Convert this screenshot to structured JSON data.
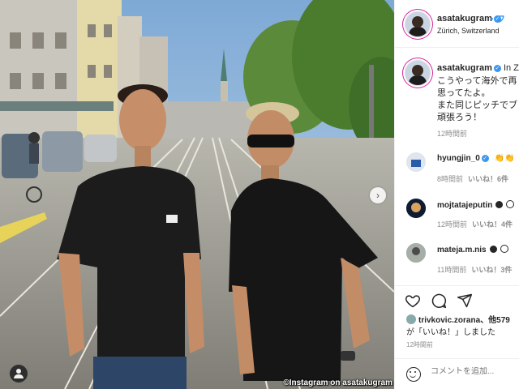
{
  "post": {
    "username": "asatakugram",
    "follow_label": "・フ",
    "location": "Zürich, Switzerland"
  },
  "caption": {
    "username": "asatakugram",
    "header_tail": "In Z",
    "body": "こうやって海外で再\n思ってたよ。\nまた同じピッチでブ\n頑張ろう！",
    "time": "12時間前"
  },
  "comments": [
    {
      "user": "hyungjin_0",
      "verified": true,
      "text": "👏👏",
      "time": "8時間前",
      "likes": "いいね！6件"
    },
    {
      "user": "mojtatajeputin",
      "verified": true,
      "text": "",
      "time": "12時間前",
      "likes": "いいね！4件"
    },
    {
      "user": "mateja.m.nis",
      "verified": false,
      "text": "",
      "time": "11時間前",
      "likes": "いいね！3件"
    }
  ],
  "likes": {
    "line1_user": "trivkovic.zorana",
    "line1_tail": "、他579",
    "line2": "が「いいね！」しました"
  },
  "post_time": "12時間前",
  "composer": {
    "placeholder": "コメントを追加..."
  },
  "credit": "©Instagram on asatakugram",
  "icons": [
    "heart-icon",
    "comment-icon",
    "share-icon",
    "emoji-icon",
    "user-tag-icon",
    "next-arrow-icon"
  ],
  "colors": {
    "accent": "#3897f0",
    "text": "#262626",
    "muted": "#8e8e8e"
  }
}
